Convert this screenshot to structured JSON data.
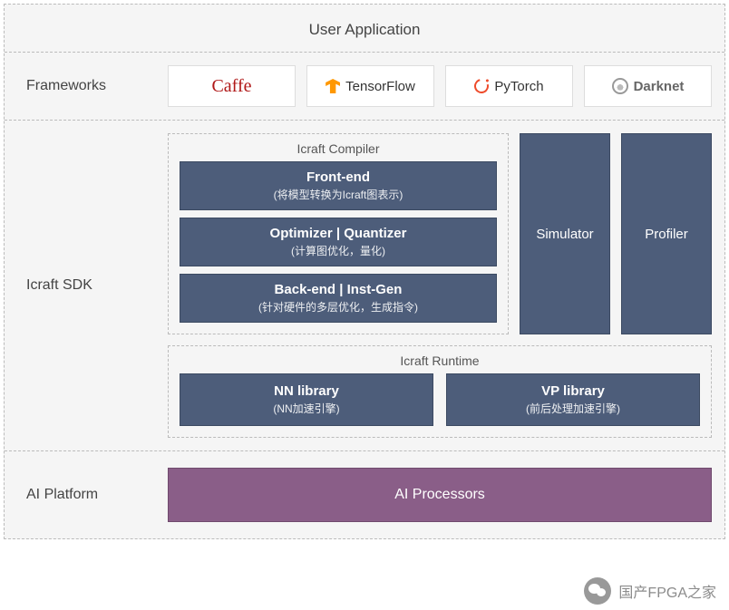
{
  "title": "User Application",
  "rows": {
    "frameworks": {
      "label": "Frameworks",
      "items": [
        "Caffe",
        "TensorFlow",
        "PyTorch",
        "Darknet"
      ]
    },
    "sdk": {
      "label": "Icraft SDK",
      "compiler": {
        "title": "Icraft Compiler",
        "blocks": [
          {
            "title": "Front-end",
            "sub": "(将模型转换为Icraft图表示)"
          },
          {
            "title": "Optimizer | Quantizer",
            "sub": "(计算图优化，量化)"
          },
          {
            "title": "Back-end | Inst-Gen",
            "sub": "(针对硬件的多层优化，生成指令)"
          }
        ]
      },
      "side": [
        "Simulator",
        "Profiler"
      ],
      "runtime": {
        "title": "Icraft Runtime",
        "blocks": [
          {
            "title": "NN library",
            "sub": "(NN加速引擎)"
          },
          {
            "title": "VP library",
            "sub": "(前后处理加速引擎)"
          }
        ]
      }
    },
    "platform": {
      "label": "AI Platform",
      "box": "AI Processors"
    }
  },
  "watermark": "国产FPGA之家"
}
